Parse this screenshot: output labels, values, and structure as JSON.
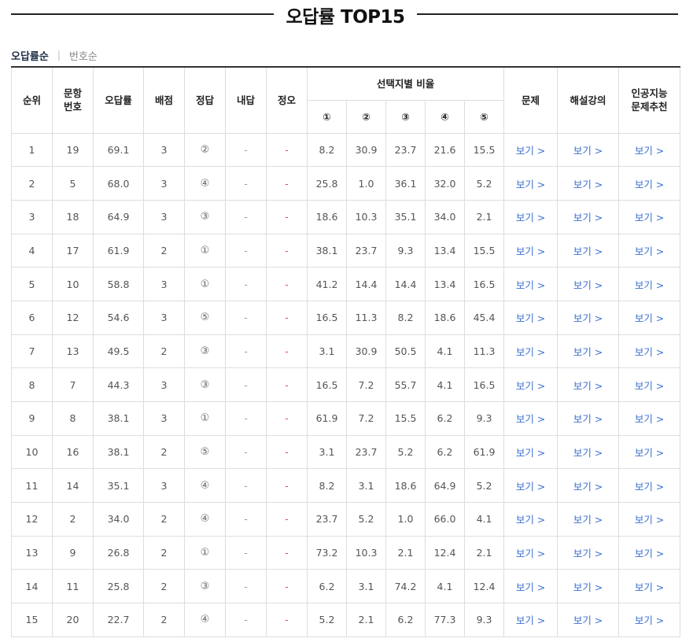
{
  "title": "오답률 TOP15",
  "sort_tabs": {
    "active": "오답률순",
    "inactive": "번호순",
    "separator": "|"
  },
  "headers": {
    "rank": "순위",
    "question_no": "문항\n번호",
    "error_rate": "오답률",
    "points": "배점",
    "answer": "정답",
    "my_answer": "내답",
    "correct_wrong": "정오",
    "choice_ratio": "선택지별 비율",
    "choices": [
      "①",
      "②",
      "③",
      "④",
      "⑤"
    ],
    "problem": "문제",
    "lecture": "해설강의",
    "ai": "인공지능\n문제추천"
  },
  "link_label": "보기 >",
  "rows": [
    {
      "rank": "1",
      "no": "19",
      "rate": "69.1",
      "pts": "3",
      "ans": "②",
      "mine": "-",
      "ox": "-",
      "c": [
        "8.2",
        "30.9",
        "23.7",
        "21.6",
        "15.5"
      ]
    },
    {
      "rank": "2",
      "no": "5",
      "rate": "68.0",
      "pts": "3",
      "ans": "④",
      "mine": "-",
      "ox": "-",
      "c": [
        "25.8",
        "1.0",
        "36.1",
        "32.0",
        "5.2"
      ]
    },
    {
      "rank": "3",
      "no": "18",
      "rate": "64.9",
      "pts": "3",
      "ans": "③",
      "mine": "-",
      "ox": "-",
      "c": [
        "18.6",
        "10.3",
        "35.1",
        "34.0",
        "2.1"
      ]
    },
    {
      "rank": "4",
      "no": "17",
      "rate": "61.9",
      "pts": "2",
      "ans": "①",
      "mine": "-",
      "ox": "-",
      "c": [
        "38.1",
        "23.7",
        "9.3",
        "13.4",
        "15.5"
      ]
    },
    {
      "rank": "5",
      "no": "10",
      "rate": "58.8",
      "pts": "3",
      "ans": "①",
      "mine": "-",
      "ox": "-",
      "c": [
        "41.2",
        "14.4",
        "14.4",
        "13.4",
        "16.5"
      ]
    },
    {
      "rank": "6",
      "no": "12",
      "rate": "54.6",
      "pts": "3",
      "ans": "⑤",
      "mine": "-",
      "ox": "-",
      "c": [
        "16.5",
        "11.3",
        "8.2",
        "18.6",
        "45.4"
      ]
    },
    {
      "rank": "7",
      "no": "13",
      "rate": "49.5",
      "pts": "2",
      "ans": "③",
      "mine": "-",
      "ox": "-",
      "c": [
        "3.1",
        "30.9",
        "50.5",
        "4.1",
        "11.3"
      ]
    },
    {
      "rank": "8",
      "no": "7",
      "rate": "44.3",
      "pts": "3",
      "ans": "③",
      "mine": "-",
      "ox": "-",
      "c": [
        "16.5",
        "7.2",
        "55.7",
        "4.1",
        "16.5"
      ]
    },
    {
      "rank": "9",
      "no": "8",
      "rate": "38.1",
      "pts": "3",
      "ans": "①",
      "mine": "-",
      "ox": "-",
      "c": [
        "61.9",
        "7.2",
        "15.5",
        "6.2",
        "9.3"
      ]
    },
    {
      "rank": "10",
      "no": "16",
      "rate": "38.1",
      "pts": "2",
      "ans": "⑤",
      "mine": "-",
      "ox": "-",
      "c": [
        "3.1",
        "23.7",
        "5.2",
        "6.2",
        "61.9"
      ]
    },
    {
      "rank": "11",
      "no": "14",
      "rate": "35.1",
      "pts": "3",
      "ans": "④",
      "mine": "-",
      "ox": "-",
      "c": [
        "8.2",
        "3.1",
        "18.6",
        "64.9",
        "5.2"
      ]
    },
    {
      "rank": "12",
      "no": "2",
      "rate": "34.0",
      "pts": "2",
      "ans": "④",
      "mine": "-",
      "ox": "-",
      "c": [
        "23.7",
        "5.2",
        "1.0",
        "66.0",
        "4.1"
      ]
    },
    {
      "rank": "13",
      "no": "9",
      "rate": "26.8",
      "pts": "2",
      "ans": "①",
      "mine": "-",
      "ox": "-",
      "c": [
        "73.2",
        "10.3",
        "2.1",
        "12.4",
        "2.1"
      ]
    },
    {
      "rank": "14",
      "no": "11",
      "rate": "25.8",
      "pts": "2",
      "ans": "③",
      "mine": "-",
      "ox": "-",
      "c": [
        "6.2",
        "3.1",
        "74.2",
        "4.1",
        "12.4"
      ]
    },
    {
      "rank": "15",
      "no": "20",
      "rate": "22.7",
      "pts": "2",
      "ans": "④",
      "mine": "-",
      "ox": "-",
      "c": [
        "5.2",
        "2.1",
        "6.2",
        "77.3",
        "9.3"
      ]
    }
  ],
  "colors": {
    "link": "#3b6fd0",
    "wrong_mark": "#e24b4b",
    "title_line": "#222222"
  }
}
